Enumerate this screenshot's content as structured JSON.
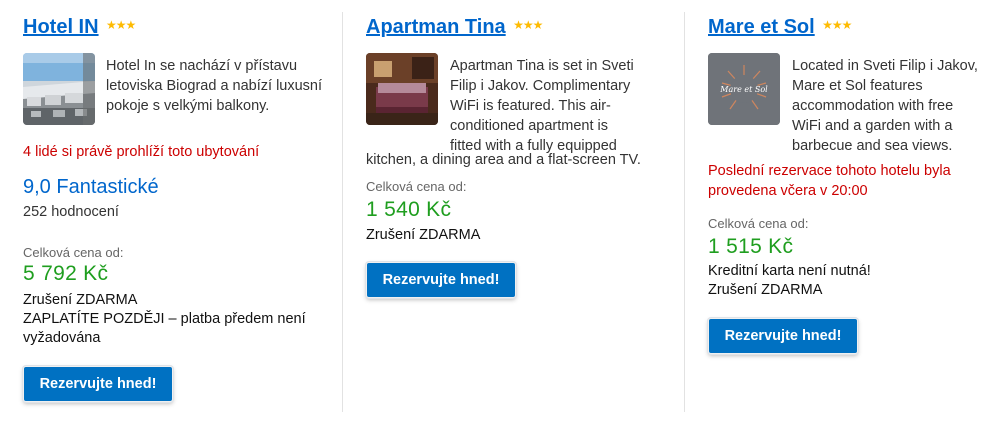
{
  "hotels": [
    {
      "name": "Hotel IN",
      "stars": "★★★",
      "description": "Hotel In se nachází v přístavu letoviska Biograd a nabízí luxusní pokoje s velkými balkony.",
      "urgency": "4 lidé si právě prohlíží toto ubytování",
      "score": "9,0 Fantastické",
      "reviews": "252 hodnocení",
      "price_label": "Celková cena od:",
      "price": "5 792 Kč",
      "notes": [
        "Zrušení ZDARMA",
        "ZAPLATÍTE POZDĚJI – platba předem není",
        "vyžadována"
      ],
      "button": "Rezervujte hned!"
    },
    {
      "name": "Apartman Tina",
      "stars": "★★★",
      "description_lines": [
        "Apartman Tina is set in Sveti",
        "Filip i Jakov. Complimentary",
        "WiFi is featured. This air-",
        "conditioned apartment is",
        "fitted with a fully equipped"
      ],
      "description_tail": "kitchen, a dining area and a flat-screen TV.",
      "price_label": "Celková cena od:",
      "price": "1 540 Kč",
      "notes": [
        "Zrušení ZDARMA"
      ],
      "button": "Rezervujte hned!"
    },
    {
      "name": "Mare et Sol",
      "stars": "★★★",
      "logo_text": "Mare et Sol",
      "description": "Located in Sveti Filip i Jakov, Mare et Sol features accommodation with free WiFi and a garden with a barbecue and sea views.",
      "urgency": "Poslední rezervace tohoto hotelu byla provedena včera v 20:00",
      "price_label": "Celková cena od:",
      "price": "1 515 Kč",
      "notes": [
        "Kreditní karta není nutná!",
        "Zrušení ZDARMA"
      ],
      "button": "Rezervujte hned!"
    }
  ],
  "colors": {
    "link": "#0066cc",
    "price": "#1f9e1f",
    "urgent": "#cc0000",
    "button": "#0071c2",
    "star": "#febb02"
  }
}
